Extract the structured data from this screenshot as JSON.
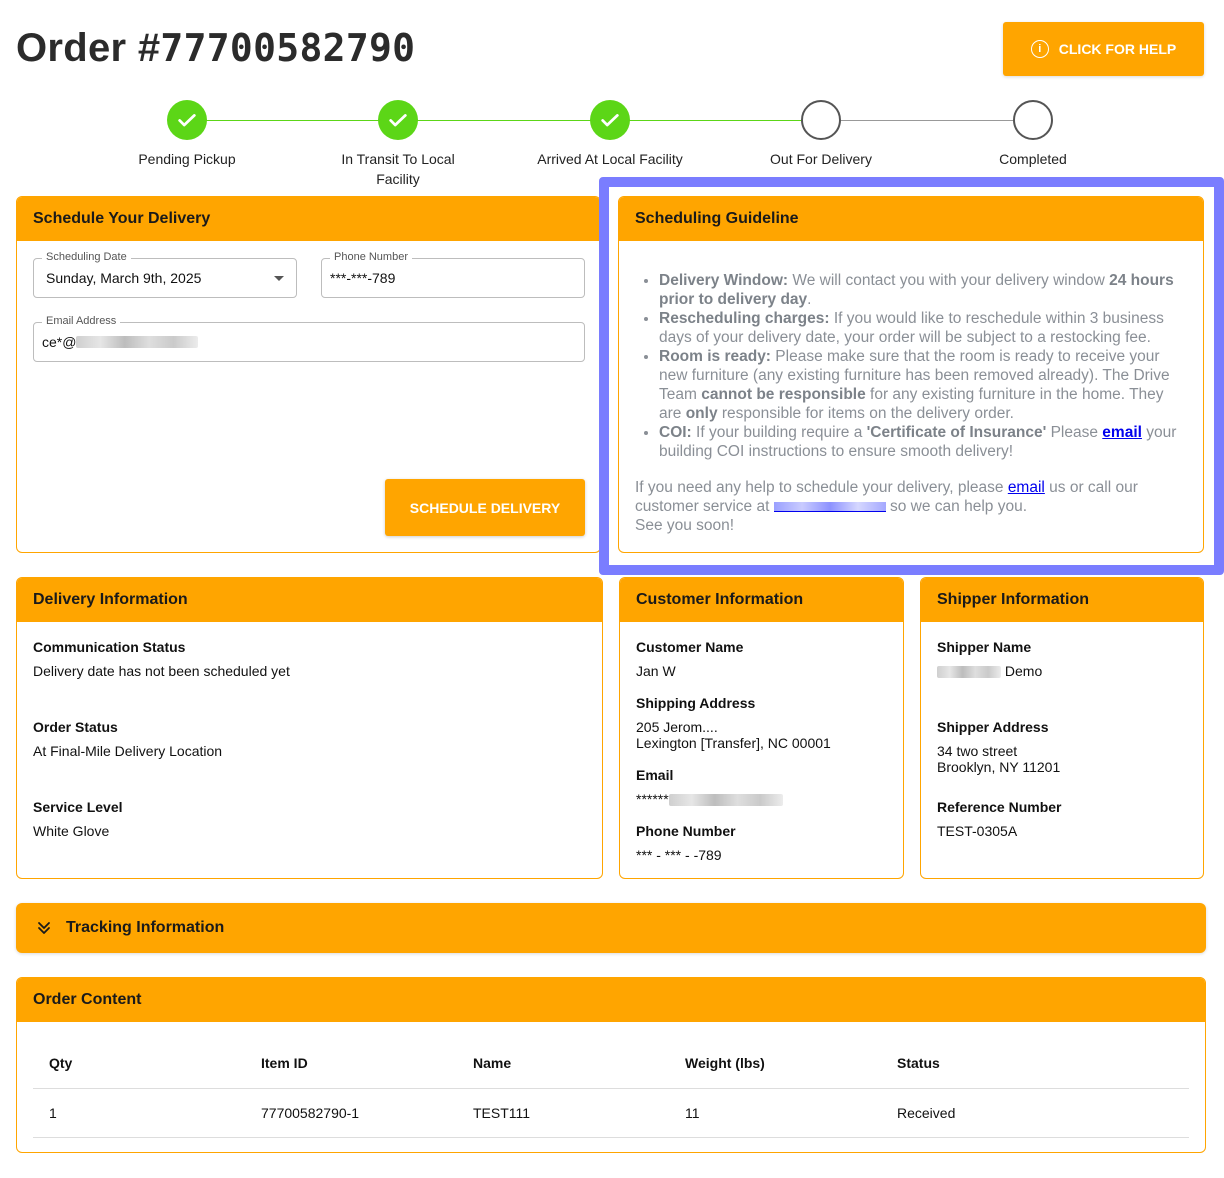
{
  "header": {
    "order_prefix": "Order #",
    "order_number": "77700582790",
    "help_label": "CLICK FOR HELP"
  },
  "stepper": {
    "steps": [
      {
        "label": "Pending Pickup",
        "done": true
      },
      {
        "label": "In Transit To Local Facility",
        "done": true
      },
      {
        "label": "Arrived At Local Facility",
        "done": true
      },
      {
        "label": "Out For Delivery",
        "done": false
      },
      {
        "label": "Completed",
        "done": false
      }
    ]
  },
  "schedule": {
    "title": "Schedule Your Delivery",
    "date_label": "Scheduling Date",
    "date_value": "Sunday, March 9th, 2025",
    "phone_label": "Phone Number",
    "phone_value": "***-***-789",
    "email_label": "Email Address",
    "email_value": "ce*@",
    "button": "SCHEDULE DELIVERY"
  },
  "guideline": {
    "title": "Scheduling Guideline",
    "b1_title": "Delivery Window:",
    "b1_text": " We will contact you with your delivery window ",
    "b1_bold": "24 hours prior to delivery day",
    "b1_end": ".",
    "b2_title": "Rescheduling charges:",
    "b2_text": " If you would like to reschedule within 3 business days of your delivery date, your order will be subject to a restocking fee.",
    "b3_title": "Room is ready:",
    "b3_text": " Please make sure that the room is ready to receive your new furniture (any existing furniture has been removed already). The Drive Team ",
    "b3_bold": "cannot be responsible",
    "b3_text2": " for any existing furniture in the home. They are ",
    "b3_bold2": "only",
    "b3_text3": " responsible for items on the delivery order.",
    "b4_title": "COI:",
    "b4_text": " If your building require a ",
    "b4_bold": "'Certificate of Insurance'",
    "b4_text2": " Please ",
    "b4_link": "email",
    "b4_text3": " your building COI instructions to ensure smooth delivery!",
    "help_text1": "If you need any help to schedule your delivery, please ",
    "help_link": "email",
    "help_text2": " us or call our customer service at ",
    "help_text3": " so we can help you.",
    "see_you": "See you soon!"
  },
  "delivery_info": {
    "title": "Delivery Information",
    "comm_label": "Communication Status",
    "comm_value": "Delivery date has not been scheduled yet",
    "status_label": "Order Status",
    "status_value": "At Final-Mile Delivery Location",
    "service_label": "Service Level",
    "service_value": "White Glove"
  },
  "customer_info": {
    "title": "Customer Information",
    "name_label": "Customer Name",
    "name_value": "Jan W",
    "address_label": "Shipping Address",
    "address_line1": "205 Jerom....",
    "address_line2": "Lexington [Transfer], NC 00001",
    "email_label": "Email",
    "email_value": "******",
    "phone_label": "Phone Number",
    "phone_value": "*** - *** - -789"
  },
  "shipper_info": {
    "title": "Shipper Information",
    "name_label": "Shipper Name",
    "name_value": " Demo",
    "address_label": "Shipper Address",
    "address_line1": "34 two street",
    "address_line2": "Brooklyn, NY 11201",
    "ref_label": "Reference Number",
    "ref_value": "TEST-0305A"
  },
  "tracking": {
    "title": "Tracking Information"
  },
  "order_content": {
    "title": "Order Content",
    "columns": [
      "Qty",
      "Item ID",
      "Name",
      "Weight (lbs)",
      "Status"
    ],
    "rows": [
      [
        "1",
        "77700582790-1",
        "TEST111",
        "11",
        "Received"
      ]
    ]
  },
  "colors": {
    "accent": "#ffa500",
    "done": "#5cd617",
    "highlight": "#7a7dff"
  }
}
